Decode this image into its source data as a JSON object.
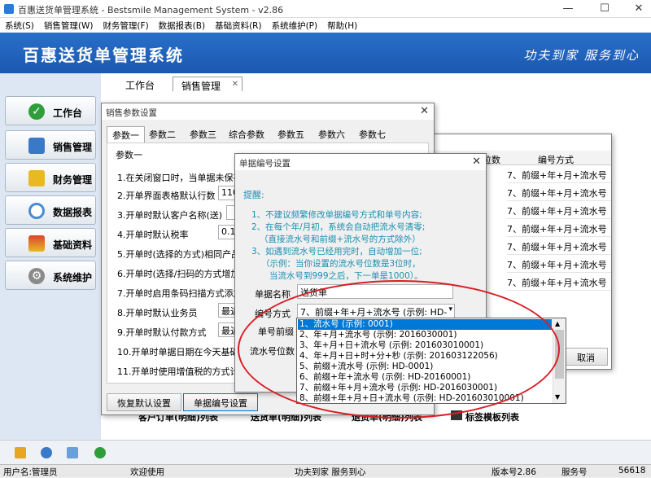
{
  "window": {
    "title": "百惠送货单管理系统 - Bestsmile Management System - v2.86",
    "buttons": [
      "—",
      "☐",
      "✕"
    ]
  },
  "menu": [
    "系统(S)",
    "销售管理(W)",
    "财务管理(F)",
    "数据报表(B)",
    "基础资料(R)",
    "系统维护(P)",
    "帮助(H)"
  ],
  "banner": {
    "title": "百惠送货单管理系统",
    "slogan": "功夫到家 服务到心"
  },
  "worktabs": [
    "工作台",
    "销售管理"
  ],
  "sidebar": [
    {
      "label": "工作台",
      "icon": "check-icon",
      "color": "#2e9e3a"
    },
    {
      "label": "销售管理",
      "icon": "sales-icon",
      "color": "#3a79c8"
    },
    {
      "label": "财务管理",
      "icon": "folder-icon",
      "color": "#e8b923"
    },
    {
      "label": "数据报表",
      "icon": "magnifier-icon",
      "color": "#4a8bd0"
    },
    {
      "label": "基础资料",
      "icon": "building-icon",
      "color": "#d9462e"
    },
    {
      "label": "系统维护",
      "icon": "gear-icon",
      "color": "#8a8a8a"
    }
  ],
  "salesParams": {
    "title": "销售参数设置",
    "tabs": [
      "参数一",
      "参数二",
      "参数三",
      "综合参数",
      "参数五",
      "参数六",
      "参数七"
    ],
    "group": "参数一",
    "rows": [
      "1.在关闭窗口时，当单据未保存",
      "2.开单界面表格默认行数",
      "3.开单时默认客户名称(送)",
      "4.开单时默认税率",
      "5.开单时(选择的方式)相同产品",
      "6.开单时(选择/扫码的方式增加",
      "7.开单时启用条码扫描方式添加",
      "8.开单时默认业务员",
      "9.开单时默认付款方式",
      "10.开单时单据日期在今天基础",
      "11.开单时使用增值税的方式计"
    ],
    "rowInputs": {
      "r2": "110",
      "r4": "0.1",
      "r8": "最近",
      "r9": "最近"
    },
    "resetButton": "恢复默认设置",
    "numberingButton": "单据编号设置"
  },
  "docTypeList": {
    "title": "单据类型列表",
    "col1": "位数",
    "col2": "编号方式",
    "rows": [
      "7、前缀+年+月+流水号",
      "7、前缀+年+月+流水号",
      "7、前缀+年+月+流水号",
      "7、前缀+年+月+流水号",
      "7、前缀+年+月+流水号",
      "7、前缀+年+月+流水号",
      "7、前缀+年+月+流水号"
    ],
    "cancelButton": "取消"
  },
  "numberingDialog": {
    "title": "单据编号设置",
    "tipTitle": "提醒:",
    "tips": [
      "1、不建议频繁修改单据编号方式和单号内容;",
      "2、在每个年/月初，系统会自动把流水号清零;",
      "（直接流水号和前缀+流水号的方式除外）",
      "3、如遇到流水号已经用完时，自动增加一位;",
      "（示例：当你设置的流水号位数是3位时，",
      "当流水号到999之后，下一单是1000）。"
    ],
    "nameLabel": "单据名称",
    "nameValue": "送货单",
    "methodLabel": "编号方式",
    "methodValue": "7、前缀+年+月+流水号 (示例: HD-",
    "prefixLabel": "单号前缀",
    "digitsLabel": "流水号位数",
    "options": [
      "1、流水号 (示例: 0001)",
      "2、年+月+流水号 (示例: 2016030001)",
      "3、年+月+日+流水号 (示例: 201603010001)",
      "4、年+月+日+时+分+秒 (示例: 201603122056)",
      "5、前缀+流水号 (示例: HD-0001)",
      "6、前缀+年+流水号 (示例: HD-20160001)",
      "7、前缀+年+月+流水号 (示例: HD-2016030001)",
      "8、前缀+年+月+日+流水号 (示例: HD-201603010001)"
    ],
    "selectedIndex": 0
  },
  "bottomLinks": [
    "客户订单(明细)列表",
    "送货单(明细)列表",
    "退货单(明细)列表",
    "标签模板列表"
  ],
  "status": {
    "user": "用户名:管理员",
    "welcome": "欢迎使用",
    "slogan": "功夫到家 服务到心",
    "version": "版本号2.86",
    "service": "服务号",
    "serviceNo": "56618"
  },
  "colors": {
    "banner": "#1f61b8",
    "accentGreen": "#2e9e3a",
    "highlight": "#d81f26",
    "tipText": "#1a8fb0"
  }
}
